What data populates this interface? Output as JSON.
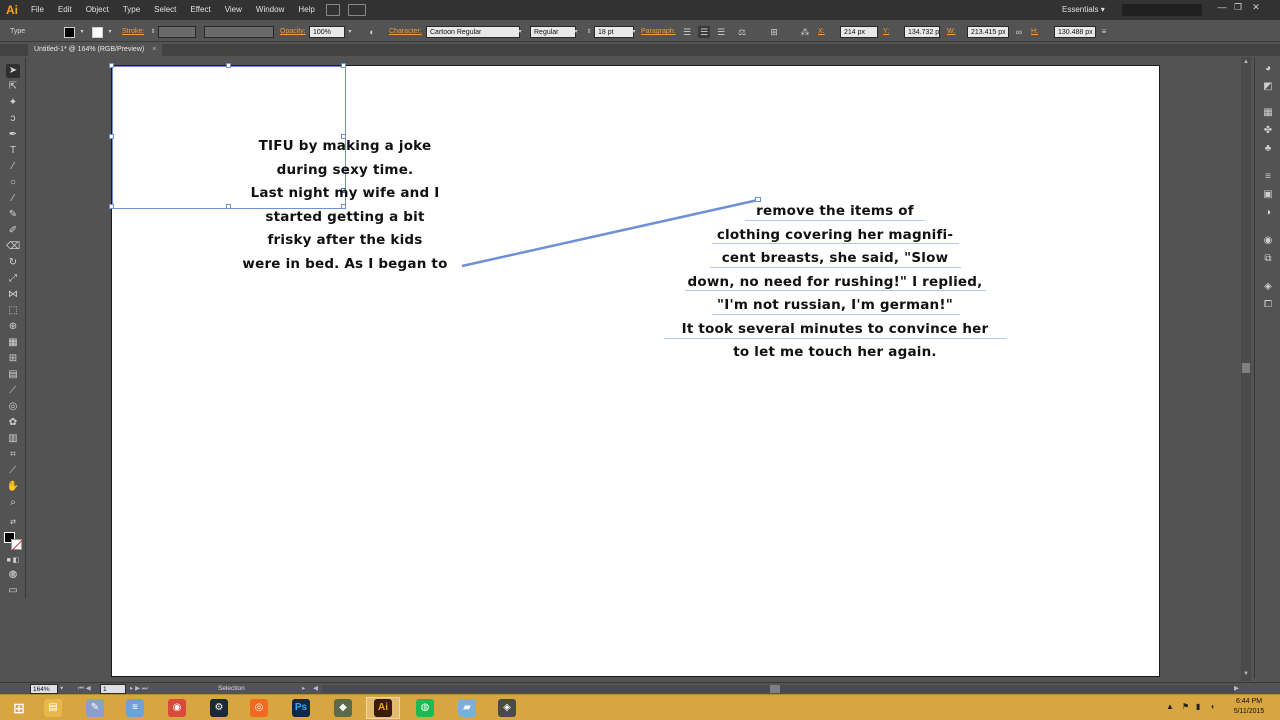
{
  "menubar": {
    "logo": "Ai",
    "items": [
      "File",
      "Edit",
      "Object",
      "Type",
      "Select",
      "Effect",
      "View",
      "Window",
      "Help"
    ],
    "workspace": "Essentials",
    "window_controls": [
      "—",
      "❐",
      "✕"
    ]
  },
  "controlbar": {
    "selection_type": "Type",
    "stroke_label": "Stroke:",
    "opacity_label": "Opacity:",
    "opacity_value": "100%",
    "character_label": "Character:",
    "font_family": "Cartoon Regular",
    "font_style": "Regular",
    "font_size": "18 pt",
    "paragraph_label": "Paragraph:",
    "x_label": "X:",
    "x_value": "214 px",
    "y_label": "Y:",
    "y_value": "134.732 px",
    "w_label": "W:",
    "w_value": "213.415 px",
    "h_label": "H:",
    "h_value": "130.488 px"
  },
  "document": {
    "tab_title": "Untitled-1* @ 164% (RGB/Preview)",
    "tab_close": "×"
  },
  "artboard": {
    "text_frame_1": {
      "lines": [
        "TIFU by making a joke",
        "during sexy time.",
        "Last night my wife and I",
        "started getting a bit",
        "frisky after the kids",
        "were in bed. As I began to"
      ]
    },
    "text_frame_2": {
      "lines": [
        "remove the items of",
        "clothing covering her magnifi-",
        "cent breasts, she said, \"Slow",
        "down, no need for rushing!\" I replied,",
        "\"I'm not russian, I'm german!\"",
        "It took several minutes to convince her",
        "to let me touch her again."
      ]
    }
  },
  "statusbar": {
    "zoom": "164%",
    "artboard_number": "1",
    "tool_name": "Selection"
  },
  "taskbar": {
    "apps": [
      {
        "name": "file-explorer",
        "glyph": "▤",
        "color": "#e8b84a"
      },
      {
        "name": "tools",
        "glyph": "✎",
        "color": "#8aa0c8"
      },
      {
        "name": "notepad",
        "glyph": "≡",
        "color": "#6fa0d8"
      },
      {
        "name": "chrome",
        "glyph": "◉",
        "color": "#d84a3a"
      },
      {
        "name": "steam",
        "glyph": "⚙",
        "color": "#1b2838"
      },
      {
        "name": "origin",
        "glyph": "◎",
        "color": "#f06a20"
      },
      {
        "name": "photoshop",
        "glyph": "Ps",
        "color": "#0b2a4a"
      },
      {
        "name": "app-8",
        "glyph": "◆",
        "color": "#5a6a4a"
      },
      {
        "name": "illustrator",
        "glyph": "Ai",
        "color": "#3a1c08"
      },
      {
        "name": "spotify",
        "glyph": "◍",
        "color": "#1db954"
      },
      {
        "name": "app-11",
        "glyph": "▰",
        "color": "#7ab0d8"
      },
      {
        "name": "app-12",
        "glyph": "◈",
        "color": "#4a4a4a"
      }
    ],
    "time": "6:44 PM",
    "date": "5/11/2015"
  },
  "colors": {
    "accent_orange": "#f39c3a",
    "selection_blue": "#6f8fd6",
    "taskbar": "#d7a640"
  }
}
